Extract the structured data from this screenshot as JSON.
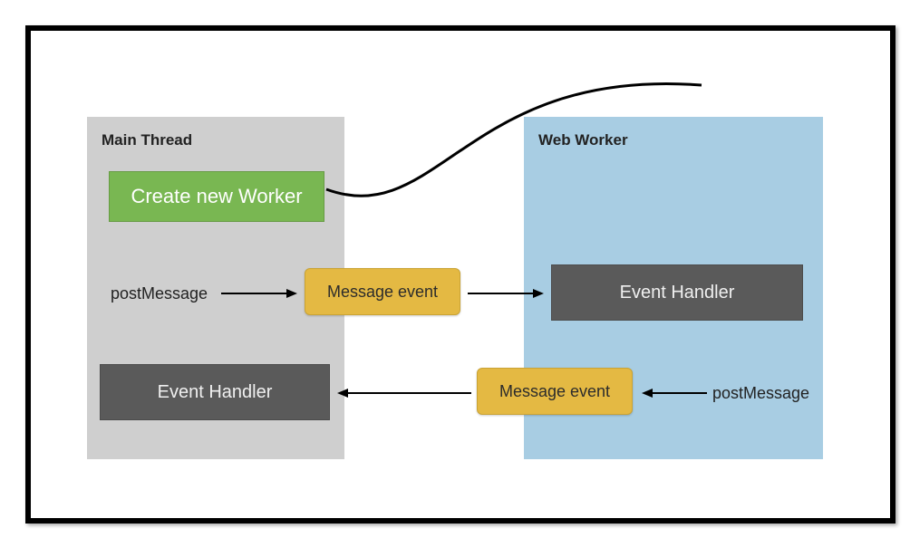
{
  "diagram": {
    "main_thread": {
      "title": "Main Thread",
      "create_worker": "Create new Worker",
      "post_message": "postMessage",
      "event_handler": "Event Handler"
    },
    "web_worker": {
      "title": "Web Worker",
      "event_handler": "Event Handler",
      "post_message": "postMessage"
    },
    "messages": {
      "msg_event_1": "Message event",
      "msg_event_2": "Message event"
    },
    "colors": {
      "main_panel": "#cfcfcf",
      "worker_panel": "#a8cde3",
      "create_block": "#79b752",
      "message_block": "#e4b943",
      "handler_block": "#5a5a5a"
    }
  }
}
